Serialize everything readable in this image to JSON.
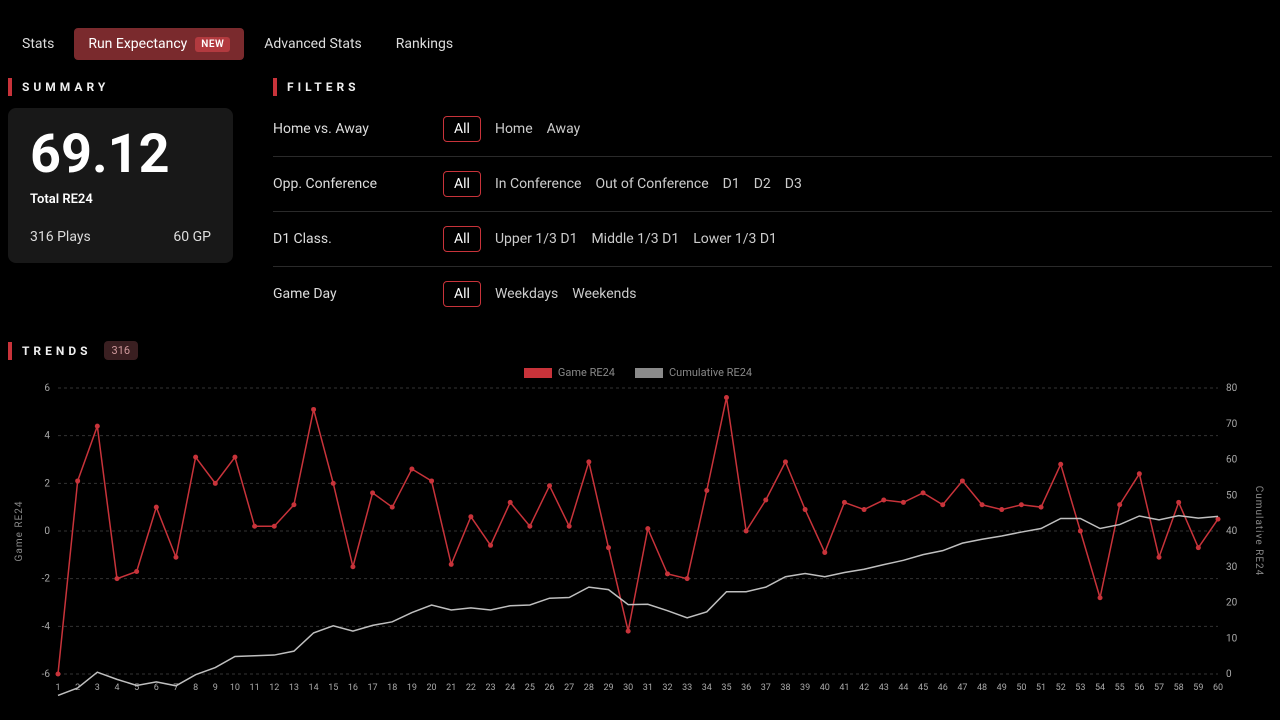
{
  "tabs": [
    {
      "label": "Stats",
      "active": false
    },
    {
      "label": "Run Expectancy",
      "active": true,
      "badge": "NEW"
    },
    {
      "label": "Advanced Stats",
      "active": false
    },
    {
      "label": "Rankings",
      "active": false
    }
  ],
  "summary": {
    "heading": "SUMMARY",
    "value": "69.12",
    "label": "Total RE24",
    "plays": "316 Plays",
    "games": "60 GP"
  },
  "filters": {
    "heading": "FILTERS",
    "rows": [
      {
        "label": "Home vs. Away",
        "options": [
          "All",
          "Home",
          "Away"
        ],
        "selected": "All"
      },
      {
        "label": "Opp. Conference",
        "options": [
          "All",
          "In Conference",
          "Out of Conference",
          "D1",
          "D2",
          "D3"
        ],
        "selected": "All"
      },
      {
        "label": "D1 Class.",
        "options": [
          "All",
          "Upper 1/3 D1",
          "Middle 1/3 D1",
          "Lower 1/3 D1"
        ],
        "selected": "All"
      },
      {
        "label": "Game Day",
        "options": [
          "All",
          "Weekdays",
          "Weekends"
        ],
        "selected": "All"
      }
    ]
  },
  "trends": {
    "heading": "TRENDS",
    "count": "316"
  },
  "legend": {
    "game": "Game RE24",
    "cumulative": "Cumulative RE24"
  },
  "chart_data": {
    "type": "line",
    "title": "",
    "xlabel": "",
    "y_left_label": "Game RE24",
    "y_right_label": "Cumulative RE24",
    "x": [
      1,
      2,
      3,
      4,
      5,
      6,
      7,
      8,
      9,
      10,
      11,
      12,
      13,
      14,
      15,
      16,
      17,
      18,
      19,
      20,
      21,
      22,
      23,
      24,
      25,
      26,
      27,
      28,
      29,
      30,
      31,
      32,
      33,
      34,
      35,
      36,
      37,
      38,
      39,
      40,
      41,
      42,
      43,
      44,
      45,
      46,
      47,
      48,
      49,
      50,
      51,
      52,
      53,
      54,
      55,
      56,
      57,
      58,
      59,
      60
    ],
    "y_left": {
      "min": -6,
      "max": 6,
      "ticks": [
        -6,
        -4,
        -2,
        0,
        2,
        4,
        6
      ]
    },
    "y_right": {
      "min": 0,
      "max": 80,
      "ticks": [
        0,
        10,
        20,
        30,
        40,
        50,
        60,
        70,
        80
      ]
    },
    "series": [
      {
        "name": "Game RE24",
        "axis": "left",
        "color": "#c8333a",
        "dots": true,
        "values": [
          -6.0,
          2.1,
          4.4,
          -2.0,
          -1.7,
          1.0,
          -1.1,
          3.1,
          2.0,
          3.1,
          0.2,
          0.2,
          1.1,
          5.1,
          2.0,
          -1.5,
          1.6,
          1.0,
          2.6,
          2.1,
          -1.4,
          0.6,
          -0.6,
          1.2,
          0.2,
          1.9,
          0.2,
          2.9,
          -0.7,
          -4.2,
          0.1,
          -1.8,
          -2.0,
          1.7,
          5.6,
          0.0,
          1.3,
          2.9,
          0.9,
          -0.9,
          1.2,
          0.9,
          1.3,
          1.2,
          1.6,
          1.1,
          2.1,
          1.1,
          0.9,
          1.1,
          1.0,
          2.8,
          0.0,
          -2.8,
          1.1,
          2.4,
          -1.1,
          1.2,
          -0.7,
          0.5
        ]
      },
      {
        "name": "Cumulative RE24",
        "axis": "right",
        "color": "#bfbfbf",
        "dots": false,
        "values": [
          -6.0,
          -3.9,
          0.5,
          -1.5,
          -3.2,
          -2.2,
          -3.3,
          -0.2,
          1.8,
          4.9,
          5.1,
          5.3,
          6.4,
          11.5,
          13.5,
          12.0,
          13.6,
          14.6,
          17.2,
          19.3,
          17.9,
          18.5,
          17.9,
          19.1,
          19.3,
          21.2,
          21.4,
          24.3,
          23.6,
          19.4,
          19.5,
          17.7,
          15.7,
          17.4,
          23.0,
          23.0,
          24.3,
          27.2,
          28.1,
          27.2,
          28.4,
          29.3,
          30.6,
          31.8,
          33.4,
          34.5,
          36.6,
          37.7,
          38.6,
          39.7,
          40.7,
          43.5,
          43.5,
          40.7,
          41.8,
          44.2,
          43.1,
          44.3,
          43.6,
          44.1
        ]
      }
    ]
  }
}
